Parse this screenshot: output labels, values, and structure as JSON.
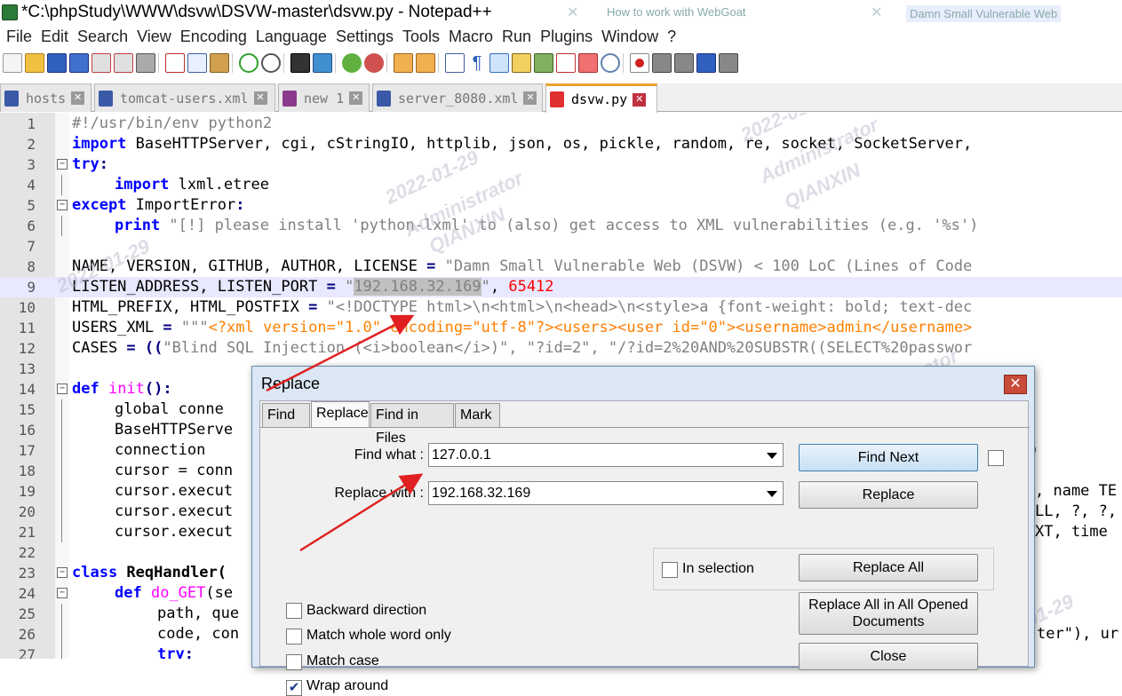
{
  "titlebar": {
    "title": "*C:\\phpStudy\\WWW\\dsvw\\DSVW-master\\dsvw.py - Notepad++",
    "bg_tab1": "How to work with WebGoat",
    "bg_tab2": "Damn Small Vulnerable Web"
  },
  "menu": [
    "File",
    "Edit",
    "Search",
    "View",
    "Encoding",
    "Language",
    "Settings",
    "Tools",
    "Macro",
    "Run",
    "Plugins",
    "Window",
    "?"
  ],
  "tabs": [
    {
      "label": "hosts",
      "active": false
    },
    {
      "label": "tomcat-users.xml",
      "active": false
    },
    {
      "label": "new 1",
      "active": false
    },
    {
      "label": "server_8080.xml",
      "active": false
    },
    {
      "label": "dsvw.py",
      "active": true
    }
  ],
  "editor": {
    "line_numbers": [
      "1",
      "2",
      "3",
      "4",
      "5",
      "6",
      "7",
      "8",
      "9",
      "10",
      "11",
      "12",
      "13",
      "14",
      "15",
      "16",
      "17",
      "18",
      "19",
      "20",
      "21",
      "22",
      "23",
      "24",
      "25",
      "26",
      "27"
    ],
    "l1": "#!/usr/bin/env python2",
    "l2_kw": "import",
    "l2_rest": " BaseHTTPServer, cgi, cStringIO, httplib, json, os, pickle, random, re, socket, SocketServer,",
    "l3_kw": "try",
    "l3_op": ":",
    "l4_kw": "import",
    "l4_rest": " lxml.etree",
    "l5_kw": "except",
    "l5_rest": " ImportError",
    "l5_op": ":",
    "l6_kw": "print",
    "l6_str": " \"[!] please install 'python-lxml' to (also) get access to XML vulnerabilities (e.g. '%s')",
    "l8_a": "NAME, VERSION, GITHUB, AUTHOR, LICENSE ",
    "l8_op": "=",
    "l8_str": " \"Damn Small Vulnerable Web (DSVW) < 100 LoC (Lines of Code",
    "l9_a": "LISTEN_ADDRESS, LISTEN_PORT ",
    "l9_op": "=",
    "l9_q1": " \"",
    "l9_sel": "192.168.32.169",
    "l9_q2": "\"",
    "l9_comma": ", ",
    "l9_num": "65412",
    "l10_a": "HTML_PREFIX, HTML_POSTFIX ",
    "l10_op": "=",
    "l10_str": " \"<!DOCTYPE html>\\n<html>\\n<head>\\n<style>a {font-weight: bold; text-dec",
    "l11_a": "USERS_XML ",
    "l11_op": "=",
    "l11_q": " \"\"\"",
    "l11_xml": "<?xml version=\"1.0\" encoding=\"utf-8\"?><users><user id=\"0\"><username>admin</username>",
    "l12_a": "CASES ",
    "l12_op": "= ((",
    "l12_str": "\"Blind SQL Injection (<i>boolean</i>)\", \"?id=2\", \"/?id=2%20AND%20SUBSTR((SELECT%20passwor",
    "l14_kw": "def",
    "l14_fn": " init",
    "l14_op": "():",
    "l15": "global conne",
    "l16": "BaseHTTPServe",
    "l17": "connection ",
    "l17_r": ")",
    "l18": "cursor = conn",
    "l19": "cursor.execut",
    "l19_r": ", name TE",
    "l20": "cursor.execut",
    "l20_r": "LL, ?, ?,",
    "l21": "cursor.execut",
    "l21_r": "XT, time",
    "l23_kw": "class",
    "l23_name": " ReqHandler(",
    "l24_kw": "def",
    "l24_fn": " do_GET",
    "l24_rest": "(se",
    "l25": "path, que",
    "l26": "code, con",
    "l26_r": "ter\"), ur",
    "l27_kw": "try",
    "l27_op": ":"
  },
  "watermark": {
    "date": "2022-01-29",
    "user": "Administrator",
    "org": "QIANXIN"
  },
  "dialog": {
    "title": "Replace",
    "close_glyph": "✕",
    "tabs": [
      "Find",
      "Replace",
      "Find in Files",
      "Mark"
    ],
    "find_label": "Find what :",
    "find_value": "127.0.0.1",
    "replace_label": "Replace with :",
    "replace_value": "192.168.32.169",
    "in_selection": "In selection",
    "buttons": {
      "find_next": "Find Next",
      "replace": "Replace",
      "replace_all": "Replace All",
      "replace_all_opened": "Replace All in All Opened Documents",
      "close": "Close"
    },
    "options": [
      {
        "label": "Backward direction",
        "checked": false
      },
      {
        "label": "Match whole word only",
        "checked": false
      },
      {
        "label": "Match case",
        "checked": false
      },
      {
        "label": "Wrap around",
        "checked": true
      }
    ]
  }
}
